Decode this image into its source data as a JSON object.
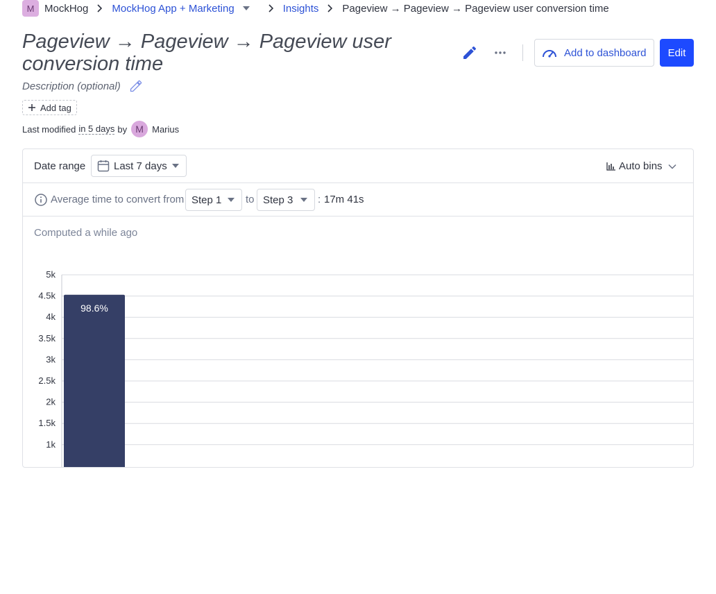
{
  "breadcrumbs": {
    "org_initial": "M",
    "org_name": "MockHog",
    "project": "MockHog App + Marketing",
    "section": "Insights",
    "current": "Pageview → Pageview → Pageview user conversion time"
  },
  "header": {
    "title": "Pageview → Pageview → Pageview user conversion time",
    "description_placeholder": "Description (optional)",
    "add_to_dashboard_label": "Add to dashboard",
    "edit_label": "Edit",
    "add_tag_label": "Add tag"
  },
  "last_modified": {
    "prefix": "Last modified",
    "when": "in 5 days",
    "by": "by",
    "user_initial": "M",
    "user_name": "Marius"
  },
  "filters": {
    "date_range_label": "Date range",
    "date_range_value": "Last 7 days",
    "bins_label": "Auto bins"
  },
  "conversion": {
    "label": "Average time to convert from",
    "from_step": "Step 1",
    "to_label": "to",
    "to_step": "Step 3",
    "colon": ":",
    "value": "17m 41s"
  },
  "status": {
    "computed": "Computed a while ago"
  },
  "colors": {
    "accent": "#1d4aff",
    "link": "#2d52d6",
    "bar": "#353f66"
  },
  "chart_data": {
    "type": "bar",
    "y_ticks": [
      "5k",
      "4.5k",
      "4k",
      "3.5k",
      "3k",
      "2.5k",
      "2k",
      "1.5k",
      "1k"
    ],
    "ylim": [
      0,
      5000
    ],
    "values": [
      4530
    ],
    "data_labels": [
      "98.6%"
    ]
  }
}
